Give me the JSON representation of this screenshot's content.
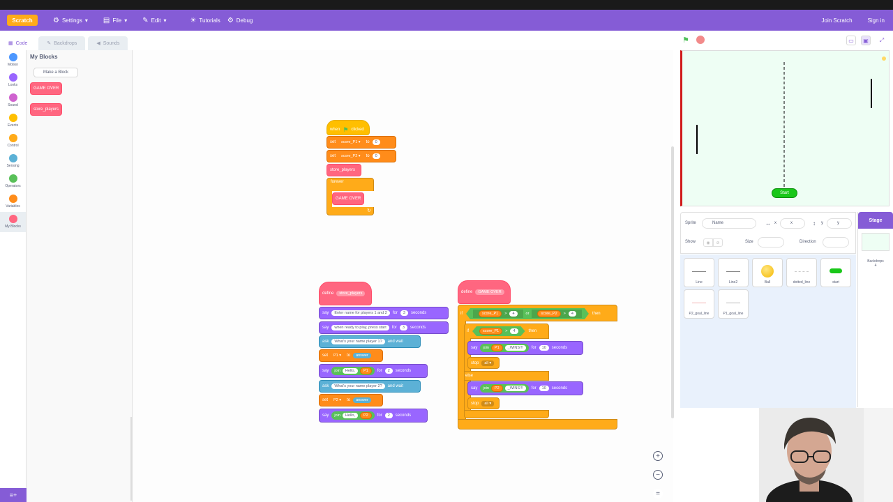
{
  "menubar": {
    "logo": "Scratch",
    "settings": "Settings",
    "file": "File",
    "edit": "Edit",
    "tutorials": "Tutorials",
    "debug": "Debug",
    "join": "Join Scratch",
    "signin": "Sign in"
  },
  "tabs": {
    "code": "Code",
    "backdrops": "Backdrops",
    "sounds": "Sounds"
  },
  "categories": [
    {
      "label": "Motion",
      "color": "#4c97ff"
    },
    {
      "label": "Looks",
      "color": "#9966ff"
    },
    {
      "label": "Sound",
      "color": "#cf63cf"
    },
    {
      "label": "Events",
      "color": "#ffbf00"
    },
    {
      "label": "Control",
      "color": "#ffab19"
    },
    {
      "label": "Sensing",
      "color": "#5cb1d6"
    },
    {
      "label": "Operators",
      "color": "#59c059"
    },
    {
      "label": "Variables",
      "color": "#ff8c1a"
    },
    {
      "label": "My Blocks",
      "color": "#ff6680"
    }
  ],
  "palette": {
    "title": "My Blocks",
    "make_block": "Make a Block",
    "block1": "GAME OVER",
    "block2": "store_players"
  },
  "script1": {
    "when": "when",
    "clicked": "clicked",
    "set": "set",
    "score_p1": "score_P1",
    "score_p2": "score_P2",
    "to": "to",
    "zero": "0",
    "store_players": "store_players",
    "forever": "forever",
    "game_over": "GAME OVER"
  },
  "script2": {
    "define": "define",
    "store_players": "store_players",
    "say": "say",
    "msg1": "Enter name for players 1 and 2",
    "for": "for",
    "three": "3",
    "seconds": "seconds",
    "msg2": "when ready to play, press start",
    "ask": "ask",
    "q1": "What's your name player 1?",
    "and_wait": "and wait",
    "set": "set",
    "p1": "P1",
    "to": "to",
    "answer": "answer",
    "join": "join",
    "hello": "Hello,",
    "two": "2",
    "q2": "What's your name player 2?",
    "p2": "P2"
  },
  "script3": {
    "define": "define",
    "game_over": "GAME OVER",
    "if": "if",
    "score_p1": "score_P1",
    "gt": ">",
    "four": "4",
    "or": "or",
    "score_p2": "score_P2",
    "then": "then",
    "say": "say",
    "join": "join",
    "p1": "P1",
    "wins": "_WINS!!!",
    "for": "for",
    "ten": "10",
    "seconds": "seconds",
    "stop": "stop",
    "all": "all",
    "else": "else",
    "p2": "P2"
  },
  "stage": {
    "start_button": "Start"
  },
  "sprite_info": {
    "sprite_label": "Sprite",
    "name_placeholder": "Name",
    "x_label": "x",
    "y_label": "y",
    "show_label": "Show",
    "size_label": "Size",
    "direction_label": "Direction"
  },
  "sprites": [
    {
      "name": "Line"
    },
    {
      "name": "Line2"
    },
    {
      "name": "Ball"
    },
    {
      "name": "dotted_line"
    },
    {
      "name": "start"
    },
    {
      "name": "P2_goal_line"
    },
    {
      "name": "P1_goal_line"
    }
  ],
  "stage_panel": {
    "title": "Stage",
    "backdrops_label": "Backdrops",
    "backdrops_count": "4"
  },
  "colors": {
    "brand": "#855cd6",
    "accent": "#ffab19"
  }
}
